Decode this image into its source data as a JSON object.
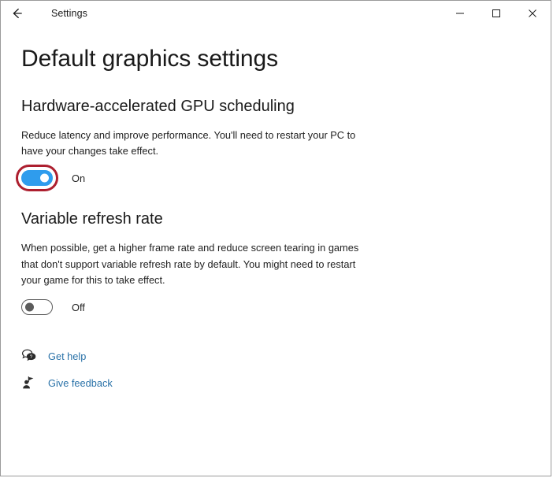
{
  "window": {
    "app_title": "Settings",
    "back_icon": "back-arrow-icon",
    "controls": {
      "minimize": "minimize-icon",
      "maximize": "maximize-icon",
      "close": "close-icon"
    }
  },
  "page": {
    "title": "Default graphics settings"
  },
  "sections": [
    {
      "title": "Hardware-accelerated GPU scheduling",
      "description": "Reduce latency and improve performance. You'll need to restart your PC to have your changes take effect.",
      "toggle": {
        "state_label": "On",
        "value": "on",
        "annotated": true
      }
    },
    {
      "title": "Variable refresh rate",
      "description": "When possible, get a higher frame rate and reduce screen tearing in games that don't support variable refresh rate by default. You might need to restart your game for this to take effect.",
      "toggle": {
        "state_label": "Off",
        "value": "off",
        "annotated": false
      }
    }
  ],
  "links": [
    {
      "label": "Get help",
      "icon": "help-bubble-icon"
    },
    {
      "label": "Give feedback",
      "icon": "feedback-person-icon"
    }
  ],
  "colors": {
    "toggle_on": "#2f9ced",
    "annotation_red": "#ad1f2f",
    "link_blue": "#2a72a8",
    "text": "#1f1f1f",
    "window_border": "#9a9a9a"
  }
}
